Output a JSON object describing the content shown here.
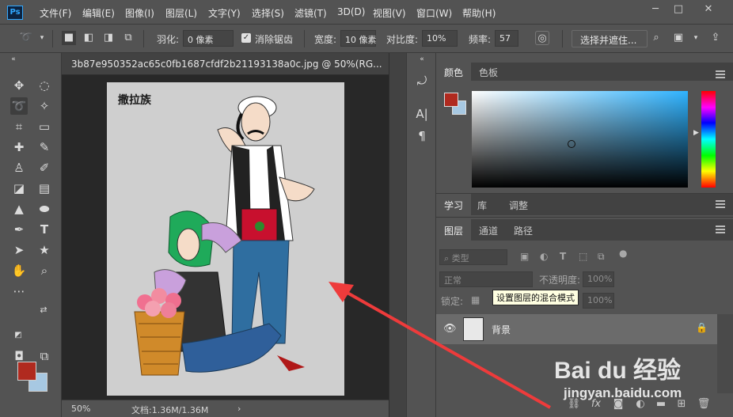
{
  "menubar": {
    "logo": "Ps",
    "items": [
      "文件(F)",
      "编辑(E)",
      "图像(I)",
      "图层(L)",
      "文字(Y)",
      "选择(S)",
      "滤镜(T)",
      "3D(D)",
      "视图(V)",
      "窗口(W)",
      "帮助(H)"
    ],
    "window_controls": [
      "─",
      "□",
      "✕"
    ]
  },
  "options": {
    "feather_label": "羽化:",
    "feather_value": "0 像素",
    "antialias_label": "消除锯齿",
    "width_label": "宽度:",
    "width_value": "10 像素",
    "contrast_label": "对比度:",
    "contrast_value": "10%",
    "frequency_label": "频率:",
    "frequency_value": "57",
    "select_mask_label": "选择并遮住..."
  },
  "document": {
    "tab_title": "3b87e950352ac65c0fb1687cfdf2b21193138a0c.jpg @ 50%(RG...",
    "canvas_title": "撒拉族"
  },
  "status": {
    "zoom": "50%",
    "doc_info": "文档:1.36M/1.36M",
    "arrow": "›"
  },
  "color_panel": {
    "tabs": [
      "颜色",
      "色板"
    ],
    "foreground": "#b02a1f",
    "background": "#a7c8e2"
  },
  "learn_panel": {
    "tabs": [
      "学习",
      "库",
      "调整"
    ]
  },
  "layers_panel": {
    "tabs": [
      "图层",
      "通道",
      "路径"
    ],
    "filter_label": "类型",
    "blend_mode": "正常",
    "opacity_label": "不透明度:",
    "opacity_value": "100%",
    "lock_label": "锁定:",
    "fill_value": "100%",
    "tooltip": "设置图层的混合模式",
    "layer_name": "背景"
  },
  "watermark": {
    "brand": "Bai du 经验",
    "url": "jingyan.baidu.com"
  },
  "colors": {
    "annotation_arrow": "#ee3b3b"
  }
}
